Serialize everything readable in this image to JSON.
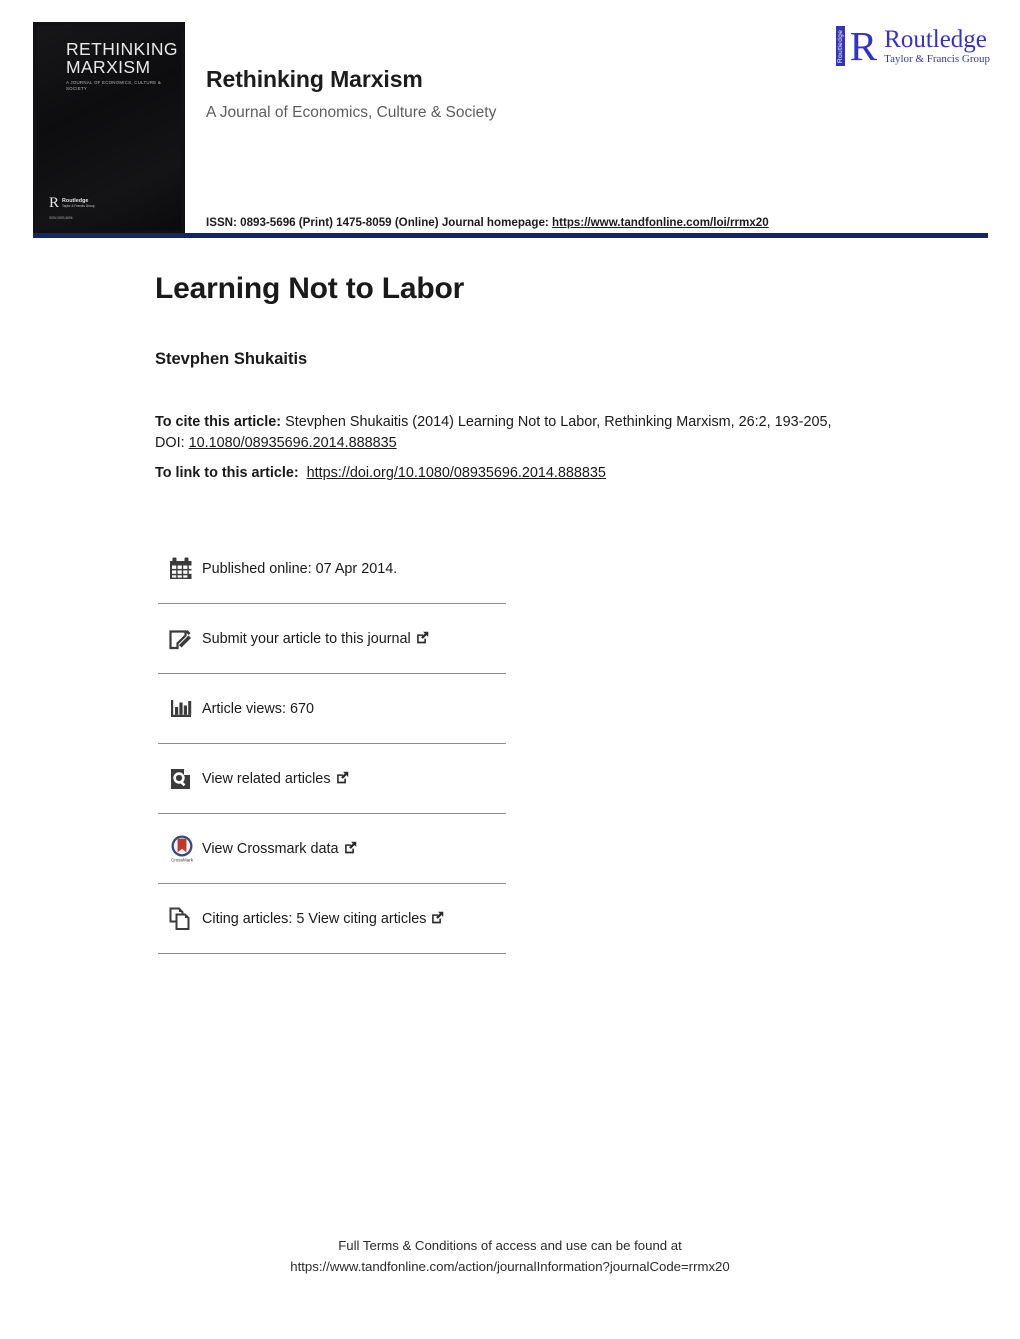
{
  "header": {
    "journal_name": "Rethinking Marxism",
    "journal_subtitle": "A Journal of Economics, Culture & Society",
    "issn_prefix": "ISSN: 0893-5696 (Print) 1475-8059 (Online) Journal homepage:",
    "homepage_url": "https://www.tandfonline.com/loi/rrmx20",
    "rule_color": "#16256b",
    "cover": {
      "title_line1": "RETHINKING",
      "title_line2": "MARXISM",
      "subtitle": "A JOURNAL OF ECONOMICS, CULTURE & SOCIETY",
      "publisher_mark": "R",
      "publisher_name": "Routledge",
      "publisher_group": "Taylor & Francis Group",
      "cover_issn": "ISSN 0893-5696",
      "vertical_label": "Routledge"
    },
    "publisher_logo": {
      "vertical_label": "Routledge",
      "mark": "R",
      "name": "Routledge",
      "group": "Taylor & Francis Group",
      "color": "#3333cc"
    }
  },
  "article": {
    "title": "Learning Not to Labor",
    "author": "Stevphen Shukaitis",
    "cite_label": "To cite this article:",
    "cite_text": " Stevphen Shukaitis (2014) Learning Not to Labor, Rethinking Marxism, 26:2, 193-205, DOI: ",
    "doi": "10.1080/08935696.2014.888835",
    "link_label": "To link to this article:",
    "link_url": "https://doi.org/10.1080/08935696.2014.888835"
  },
  "metrics": [
    {
      "icon": "calendar-icon",
      "label": "Published online: 07 Apr 2014.",
      "external": false
    },
    {
      "icon": "submit-article-icon",
      "label": "Submit your article to this journal",
      "external": true
    },
    {
      "icon": "article-views-icon",
      "label": "Article views: 670",
      "external": false
    },
    {
      "icon": "related-articles-icon",
      "label": "View related articles",
      "external": true
    },
    {
      "icon": "crossmark-icon",
      "label": "View Crossmark data",
      "external": true
    },
    {
      "icon": "citing-articles-icon",
      "label": "Citing articles: 5 View citing articles",
      "external": true
    }
  ],
  "footer": {
    "line1": "Full Terms & Conditions of access and use can be found at",
    "line2": "https://www.tandfonline.com/action/journalInformation?journalCode=rrmx20"
  }
}
